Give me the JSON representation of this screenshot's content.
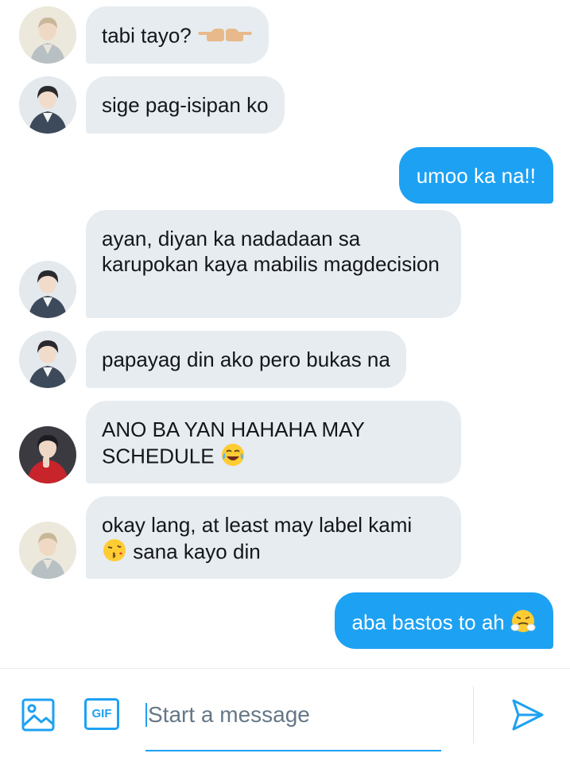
{
  "conversation": {
    "messages": [
      {
        "side": "in",
        "avatar": "avatar-light",
        "text": "tabi tayo?",
        "emoji": "pointing-hands"
      },
      {
        "side": "in",
        "avatar": "avatar-dark-suit",
        "text": "sige pag-isipan ko"
      },
      {
        "side": "out",
        "text": "umoo ka na!!"
      },
      {
        "side": "in",
        "avatar": "avatar-dark-suit",
        "text": "ayan, diyan ka nadadaan sa karupokan kaya mabilis magdecision"
      },
      {
        "side": "in",
        "avatar": "avatar-dark-suit",
        "text": "papayag din ako pero bukas na"
      },
      {
        "side": "in",
        "avatar": "avatar-red",
        "text": "ANO BA YAN HAHAHA MAY SCHEDULE",
        "emoji": "tears-of-joy"
      },
      {
        "side": "in",
        "avatar": "avatar-light",
        "text": "okay lang, at least may label kami",
        "emoji": "kissing-face",
        "text_after": "sana kayo din"
      },
      {
        "side": "out",
        "text": "aba bastos to ah",
        "emoji": "steam-face"
      }
    ]
  },
  "composer": {
    "placeholder": "Start a message",
    "gif_label": "GIF",
    "icons": [
      "image-icon",
      "gif-icon",
      "send-icon"
    ]
  },
  "colors": {
    "accent": "#1da1f2",
    "incoming_bubble": "#e6ecf0",
    "outgoing_bubble": "#1da1f2"
  }
}
